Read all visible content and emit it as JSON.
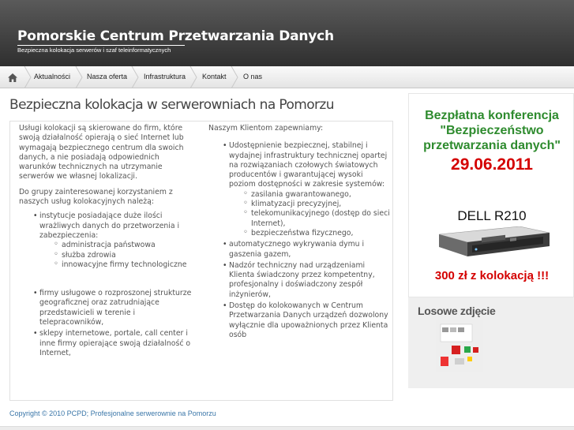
{
  "header": {
    "title": "Pomorskie Centrum Przetwarzania Danych",
    "subtitle": "Bezpieczna kolokacja serwerów i szaf teleinformatycznych"
  },
  "nav": {
    "home_icon": "home-icon",
    "items": [
      "Aktualności",
      "Nasza oferta",
      "Infrastruktura",
      "Kontakt",
      "O nas"
    ]
  },
  "main": {
    "title": "Bezpieczna kolokacja w serwerowniach na Pomorzu",
    "left": {
      "p1": "Usługi kolokacji są skierowane do firm, które swoją działalność opierają o sieć Internet lub wymagają bezpiecznego centrum dla swoich danych, a nie posiadają odpowiednich warunków technicznych na utrzymanie serwerów we własnej lokalizacji.",
      "p2": "Do grupy zainteresowanej korzystaniem z naszych usług kolokacyjnych należą:",
      "b1": "instytucje posiadające duże ilości wrażliwych danych do przetworzenia i zabezpieczenia:",
      "b1_sub": [
        "administracja państwowa",
        "służba zdrowia",
        "innowacyjne firmy technologiczne"
      ],
      "b2": "firmy usługowe o rozproszonej strukturze geograficznej oraz zatrudniające przedstawicieli w terenie i telepracowników,",
      "b3": "sklepy internetowe, portale, call center i inne firmy opierające swoją działalność o Internet,"
    },
    "right": {
      "intro": "Naszym Klientom zapewniamy:",
      "b1": "Udostępnienie bezpiecznej, stabilnej i wydajnej infrastruktury technicznej opartej na rozwiązaniach czołowych światowych producentów i gwarantującej wysoki poziom dostępności w zakresie systemów:",
      "b1_sub": [
        "zasilania gwarantowanego,",
        "klimatyzacji precyzyjnej,",
        "telekomunikacyjnego (dostęp do sieci Internet),",
        "bezpieczeństwa fizycznego,"
      ],
      "b2": "automatycznego wykrywania dymu i gaszenia gazem,",
      "b3": "Nadzór techniczny nad urządzeniami Klienta świadczony przez kompetentny, profesjonalny i doświadczony zespół inżynierów,",
      "b4": "Dostęp do kolokowanych w Centrum Przetwarzania Danych urządzeń dozwolony wyłącznie dla upoważnionych przez Klienta osób"
    }
  },
  "sidebar": {
    "promo": {
      "line1": "Bezpłatna konferencja",
      "line2": "\"Bezpieczeństwo",
      "line3": "przetwarzania danych\"",
      "date": "29.06.2011",
      "product": "DELL R210",
      "price": "300 zł z kolokacją !!!"
    },
    "random_photo_title": "Losowe zdjęcie"
  },
  "footer": {
    "text": "Copyright © 2010 PCPD; Profesjonalne serwerownie na Pomorzu"
  },
  "colors": {
    "header_dark": "#2f2f2f",
    "promo_green": "#2e8b2e",
    "promo_red": "#d40000",
    "footer_link": "#3a76a8"
  }
}
